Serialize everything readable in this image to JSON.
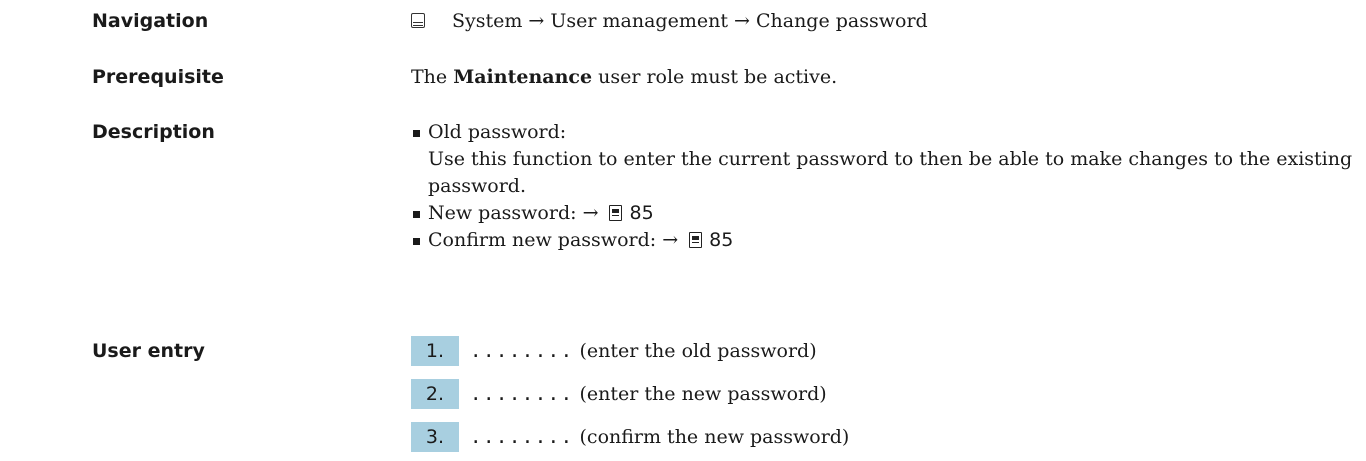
{
  "rows": {
    "navigation": {
      "label": "Navigation",
      "icon": "menu-path-icon",
      "path": "System → User management → Change password"
    },
    "prerequisite": {
      "label": "Prerequisite",
      "text_before": "The ",
      "role": "Maintenance",
      "text_after": " user role must be active."
    },
    "description": {
      "label": "Description",
      "items": [
        {
          "title": "Old password:",
          "text": "Use this function to enter the current password to then be able to make changes to the existing password."
        },
        {
          "title": "New password:",
          "arrow": "→",
          "page_icon": "page-reference-icon",
          "page": "85"
        },
        {
          "title": "Confirm new password:",
          "arrow": "→",
          "page_icon": "page-reference-icon",
          "page": "85"
        }
      ]
    },
    "user_entry": {
      "label": "User entry",
      "step_color": "#a8cfe0",
      "steps": [
        {
          "number": "1.",
          "dots": "........",
          "text": "(enter the old password)"
        },
        {
          "number": "2.",
          "dots": "........",
          "text": "(enter the new password)"
        },
        {
          "number": "3.",
          "dots": "........",
          "text": "(confirm the new password)"
        }
      ]
    }
  }
}
